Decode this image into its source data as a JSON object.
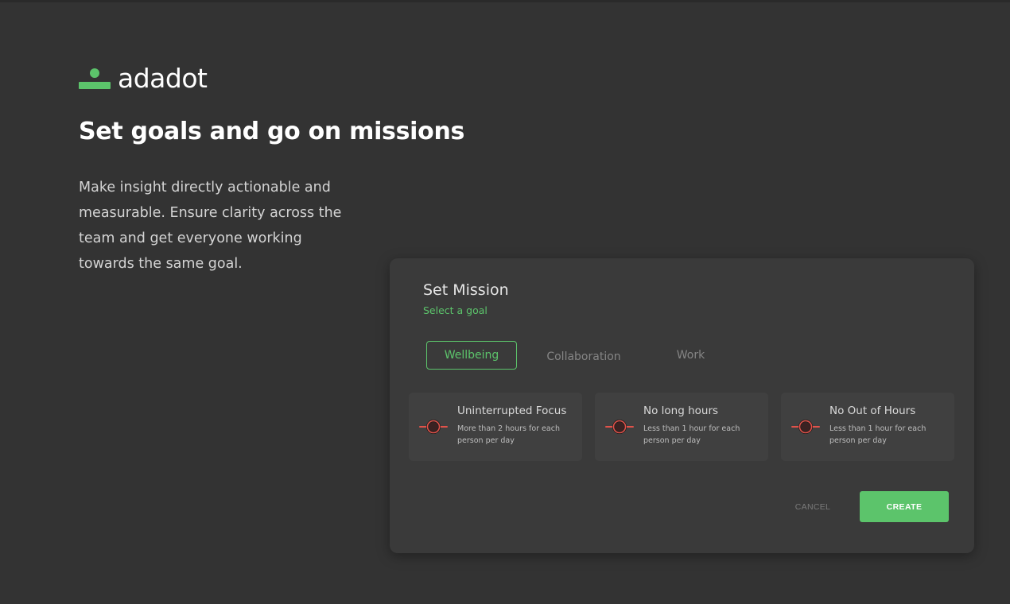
{
  "brand": {
    "name": "adadot",
    "color": "#5cc46b"
  },
  "hero": {
    "headline": "Set goals and go on missions",
    "body": "Make insight directly actionable and measurable. Ensure clarity across the team and get everyone working towards the same goal."
  },
  "mission_card": {
    "title": "Set Mission",
    "subtitle": "Select a goal",
    "tabs": [
      {
        "label": "Wellbeing",
        "active": true
      },
      {
        "label": "Collaboration",
        "active": false
      },
      {
        "label": "Work",
        "active": false
      }
    ],
    "goals": [
      {
        "title": "Uninterrupted Focus",
        "description": "More than 2 hours for each person per day",
        "icon": "mission-target-icon"
      },
      {
        "title": "No long hours",
        "description": "Less than 1 hour for each person per day",
        "icon": "mission-target-icon"
      },
      {
        "title": "No Out of Hours",
        "description": "Less than 1 hour for each person per day",
        "icon": "mission-target-icon"
      }
    ],
    "cancel_label": "CANCEL",
    "create_label": "CREATE"
  },
  "colors": {
    "background": "#333333",
    "card": "#3a3a3a",
    "accent": "#5cc46b",
    "icon_red": "#e0524a"
  }
}
